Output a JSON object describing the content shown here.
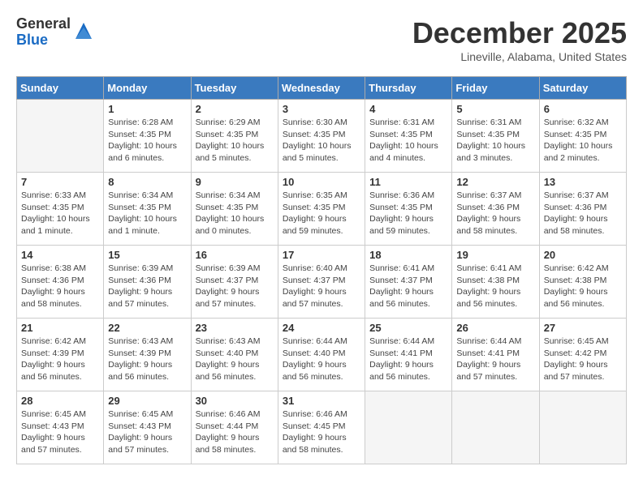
{
  "header": {
    "logo_general": "General",
    "logo_blue": "Blue",
    "month_title": "December 2025",
    "location": "Lineville, Alabama, United States"
  },
  "days_of_week": [
    "Sunday",
    "Monday",
    "Tuesday",
    "Wednesday",
    "Thursday",
    "Friday",
    "Saturday"
  ],
  "weeks": [
    [
      {
        "day": "",
        "sunrise": "",
        "sunset": "",
        "daylight": ""
      },
      {
        "day": "1",
        "sunrise": "Sunrise: 6:28 AM",
        "sunset": "Sunset: 4:35 PM",
        "daylight": "Daylight: 10 hours and 6 minutes."
      },
      {
        "day": "2",
        "sunrise": "Sunrise: 6:29 AM",
        "sunset": "Sunset: 4:35 PM",
        "daylight": "Daylight: 10 hours and 5 minutes."
      },
      {
        "day": "3",
        "sunrise": "Sunrise: 6:30 AM",
        "sunset": "Sunset: 4:35 PM",
        "daylight": "Daylight: 10 hours and 5 minutes."
      },
      {
        "day": "4",
        "sunrise": "Sunrise: 6:31 AM",
        "sunset": "Sunset: 4:35 PM",
        "daylight": "Daylight: 10 hours and 4 minutes."
      },
      {
        "day": "5",
        "sunrise": "Sunrise: 6:31 AM",
        "sunset": "Sunset: 4:35 PM",
        "daylight": "Daylight: 10 hours and 3 minutes."
      },
      {
        "day": "6",
        "sunrise": "Sunrise: 6:32 AM",
        "sunset": "Sunset: 4:35 PM",
        "daylight": "Daylight: 10 hours and 2 minutes."
      }
    ],
    [
      {
        "day": "7",
        "sunrise": "Sunrise: 6:33 AM",
        "sunset": "Sunset: 4:35 PM",
        "daylight": "Daylight: 10 hours and 1 minute."
      },
      {
        "day": "8",
        "sunrise": "Sunrise: 6:34 AM",
        "sunset": "Sunset: 4:35 PM",
        "daylight": "Daylight: 10 hours and 1 minute."
      },
      {
        "day": "9",
        "sunrise": "Sunrise: 6:34 AM",
        "sunset": "Sunset: 4:35 PM",
        "daylight": "Daylight: 10 hours and 0 minutes."
      },
      {
        "day": "10",
        "sunrise": "Sunrise: 6:35 AM",
        "sunset": "Sunset: 4:35 PM",
        "daylight": "Daylight: 9 hours and 59 minutes."
      },
      {
        "day": "11",
        "sunrise": "Sunrise: 6:36 AM",
        "sunset": "Sunset: 4:35 PM",
        "daylight": "Daylight: 9 hours and 59 minutes."
      },
      {
        "day": "12",
        "sunrise": "Sunrise: 6:37 AM",
        "sunset": "Sunset: 4:36 PM",
        "daylight": "Daylight: 9 hours and 58 minutes."
      },
      {
        "day": "13",
        "sunrise": "Sunrise: 6:37 AM",
        "sunset": "Sunset: 4:36 PM",
        "daylight": "Daylight: 9 hours and 58 minutes."
      }
    ],
    [
      {
        "day": "14",
        "sunrise": "Sunrise: 6:38 AM",
        "sunset": "Sunset: 4:36 PM",
        "daylight": "Daylight: 9 hours and 58 minutes."
      },
      {
        "day": "15",
        "sunrise": "Sunrise: 6:39 AM",
        "sunset": "Sunset: 4:36 PM",
        "daylight": "Daylight: 9 hours and 57 minutes."
      },
      {
        "day": "16",
        "sunrise": "Sunrise: 6:39 AM",
        "sunset": "Sunset: 4:37 PM",
        "daylight": "Daylight: 9 hours and 57 minutes."
      },
      {
        "day": "17",
        "sunrise": "Sunrise: 6:40 AM",
        "sunset": "Sunset: 4:37 PM",
        "daylight": "Daylight: 9 hours and 57 minutes."
      },
      {
        "day": "18",
        "sunrise": "Sunrise: 6:41 AM",
        "sunset": "Sunset: 4:37 PM",
        "daylight": "Daylight: 9 hours and 56 minutes."
      },
      {
        "day": "19",
        "sunrise": "Sunrise: 6:41 AM",
        "sunset": "Sunset: 4:38 PM",
        "daylight": "Daylight: 9 hours and 56 minutes."
      },
      {
        "day": "20",
        "sunrise": "Sunrise: 6:42 AM",
        "sunset": "Sunset: 4:38 PM",
        "daylight": "Daylight: 9 hours and 56 minutes."
      }
    ],
    [
      {
        "day": "21",
        "sunrise": "Sunrise: 6:42 AM",
        "sunset": "Sunset: 4:39 PM",
        "daylight": "Daylight: 9 hours and 56 minutes."
      },
      {
        "day": "22",
        "sunrise": "Sunrise: 6:43 AM",
        "sunset": "Sunset: 4:39 PM",
        "daylight": "Daylight: 9 hours and 56 minutes."
      },
      {
        "day": "23",
        "sunrise": "Sunrise: 6:43 AM",
        "sunset": "Sunset: 4:40 PM",
        "daylight": "Daylight: 9 hours and 56 minutes."
      },
      {
        "day": "24",
        "sunrise": "Sunrise: 6:44 AM",
        "sunset": "Sunset: 4:40 PM",
        "daylight": "Daylight: 9 hours and 56 minutes."
      },
      {
        "day": "25",
        "sunrise": "Sunrise: 6:44 AM",
        "sunset": "Sunset: 4:41 PM",
        "daylight": "Daylight: 9 hours and 56 minutes."
      },
      {
        "day": "26",
        "sunrise": "Sunrise: 6:44 AM",
        "sunset": "Sunset: 4:41 PM",
        "daylight": "Daylight: 9 hours and 57 minutes."
      },
      {
        "day": "27",
        "sunrise": "Sunrise: 6:45 AM",
        "sunset": "Sunset: 4:42 PM",
        "daylight": "Daylight: 9 hours and 57 minutes."
      }
    ],
    [
      {
        "day": "28",
        "sunrise": "Sunrise: 6:45 AM",
        "sunset": "Sunset: 4:43 PM",
        "daylight": "Daylight: 9 hours and 57 minutes."
      },
      {
        "day": "29",
        "sunrise": "Sunrise: 6:45 AM",
        "sunset": "Sunset: 4:43 PM",
        "daylight": "Daylight: 9 hours and 57 minutes."
      },
      {
        "day": "30",
        "sunrise": "Sunrise: 6:46 AM",
        "sunset": "Sunset: 4:44 PM",
        "daylight": "Daylight: 9 hours and 58 minutes."
      },
      {
        "day": "31",
        "sunrise": "Sunrise: 6:46 AM",
        "sunset": "Sunset: 4:45 PM",
        "daylight": "Daylight: 9 hours and 58 minutes."
      },
      {
        "day": "",
        "sunrise": "",
        "sunset": "",
        "daylight": ""
      },
      {
        "day": "",
        "sunrise": "",
        "sunset": "",
        "daylight": ""
      },
      {
        "day": "",
        "sunrise": "",
        "sunset": "",
        "daylight": ""
      }
    ]
  ]
}
